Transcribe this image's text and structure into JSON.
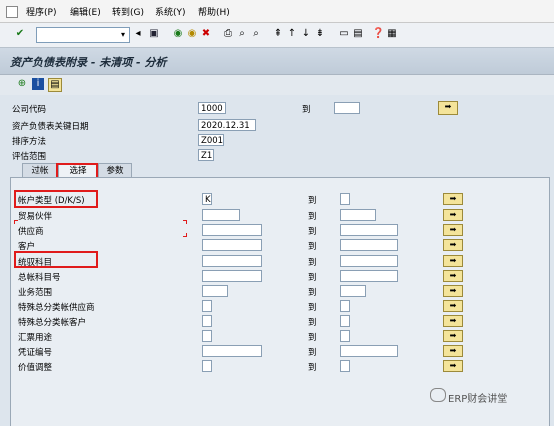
{
  "menu": {
    "items": [
      "程序(P)",
      "编辑(E)",
      "转到(G)",
      "系统(Y)",
      "帮助(H)"
    ]
  },
  "toolbar": {
    "command_value": "",
    "icons": [
      "enter-icon",
      "save-icon",
      "back-icon",
      "exit-icon",
      "cancel-icon",
      "print-icon",
      "find-icon",
      "find-next-icon",
      "first-page-icon",
      "prev-page-icon",
      "next-page-icon",
      "last-page-icon",
      "create-session-icon",
      "shortcut-icon",
      "help-icon",
      "layout-icon"
    ]
  },
  "title": "资产负债表附录 - 未清项 - 分析",
  "header_fields": {
    "company_code_label": "公司代码",
    "company_code_value": "1000",
    "to_label": "到",
    "key_date_label": "资产负债表关键日期",
    "key_date_value": "2020.12.31",
    "sort_method_label": "排序方法",
    "sort_method_value": "Z001",
    "valuation_area_label": "评估范围",
    "valuation_area_value": "Z1"
  },
  "tabs": [
    {
      "label": "过帐",
      "active": false
    },
    {
      "label": "选择",
      "active": true
    },
    {
      "label": "参数",
      "active": false
    }
  ],
  "selection_rows": [
    {
      "label": "帐户类型 (D/K/S)",
      "from": "K",
      "to": ""
    },
    {
      "label": "贸易伙伴",
      "from": "",
      "to": ""
    },
    {
      "label": "供应商",
      "from": "",
      "to": ""
    },
    {
      "label": "客户",
      "from": "",
      "to": ""
    },
    {
      "label": "统驭科目",
      "from": "",
      "to": ""
    },
    {
      "label": "总帐科目号",
      "from": "",
      "to": ""
    },
    {
      "label": "业务范围",
      "from": "",
      "to": ""
    },
    {
      "label": "特殊总分类帐供应商",
      "from": "",
      "to": ""
    },
    {
      "label": "特殊总分类帐客户",
      "from": "",
      "to": ""
    },
    {
      "label": "汇票用途",
      "from": "",
      "to": ""
    },
    {
      "label": "凭证编号",
      "from": "",
      "to": ""
    },
    {
      "label": "价值调整",
      "from": "",
      "to": ""
    }
  ],
  "to_label": "到",
  "watermark": "ERP财会讲堂",
  "colors": {
    "highlight": "#e01b1b",
    "exec_button": "#f4e49a"
  }
}
